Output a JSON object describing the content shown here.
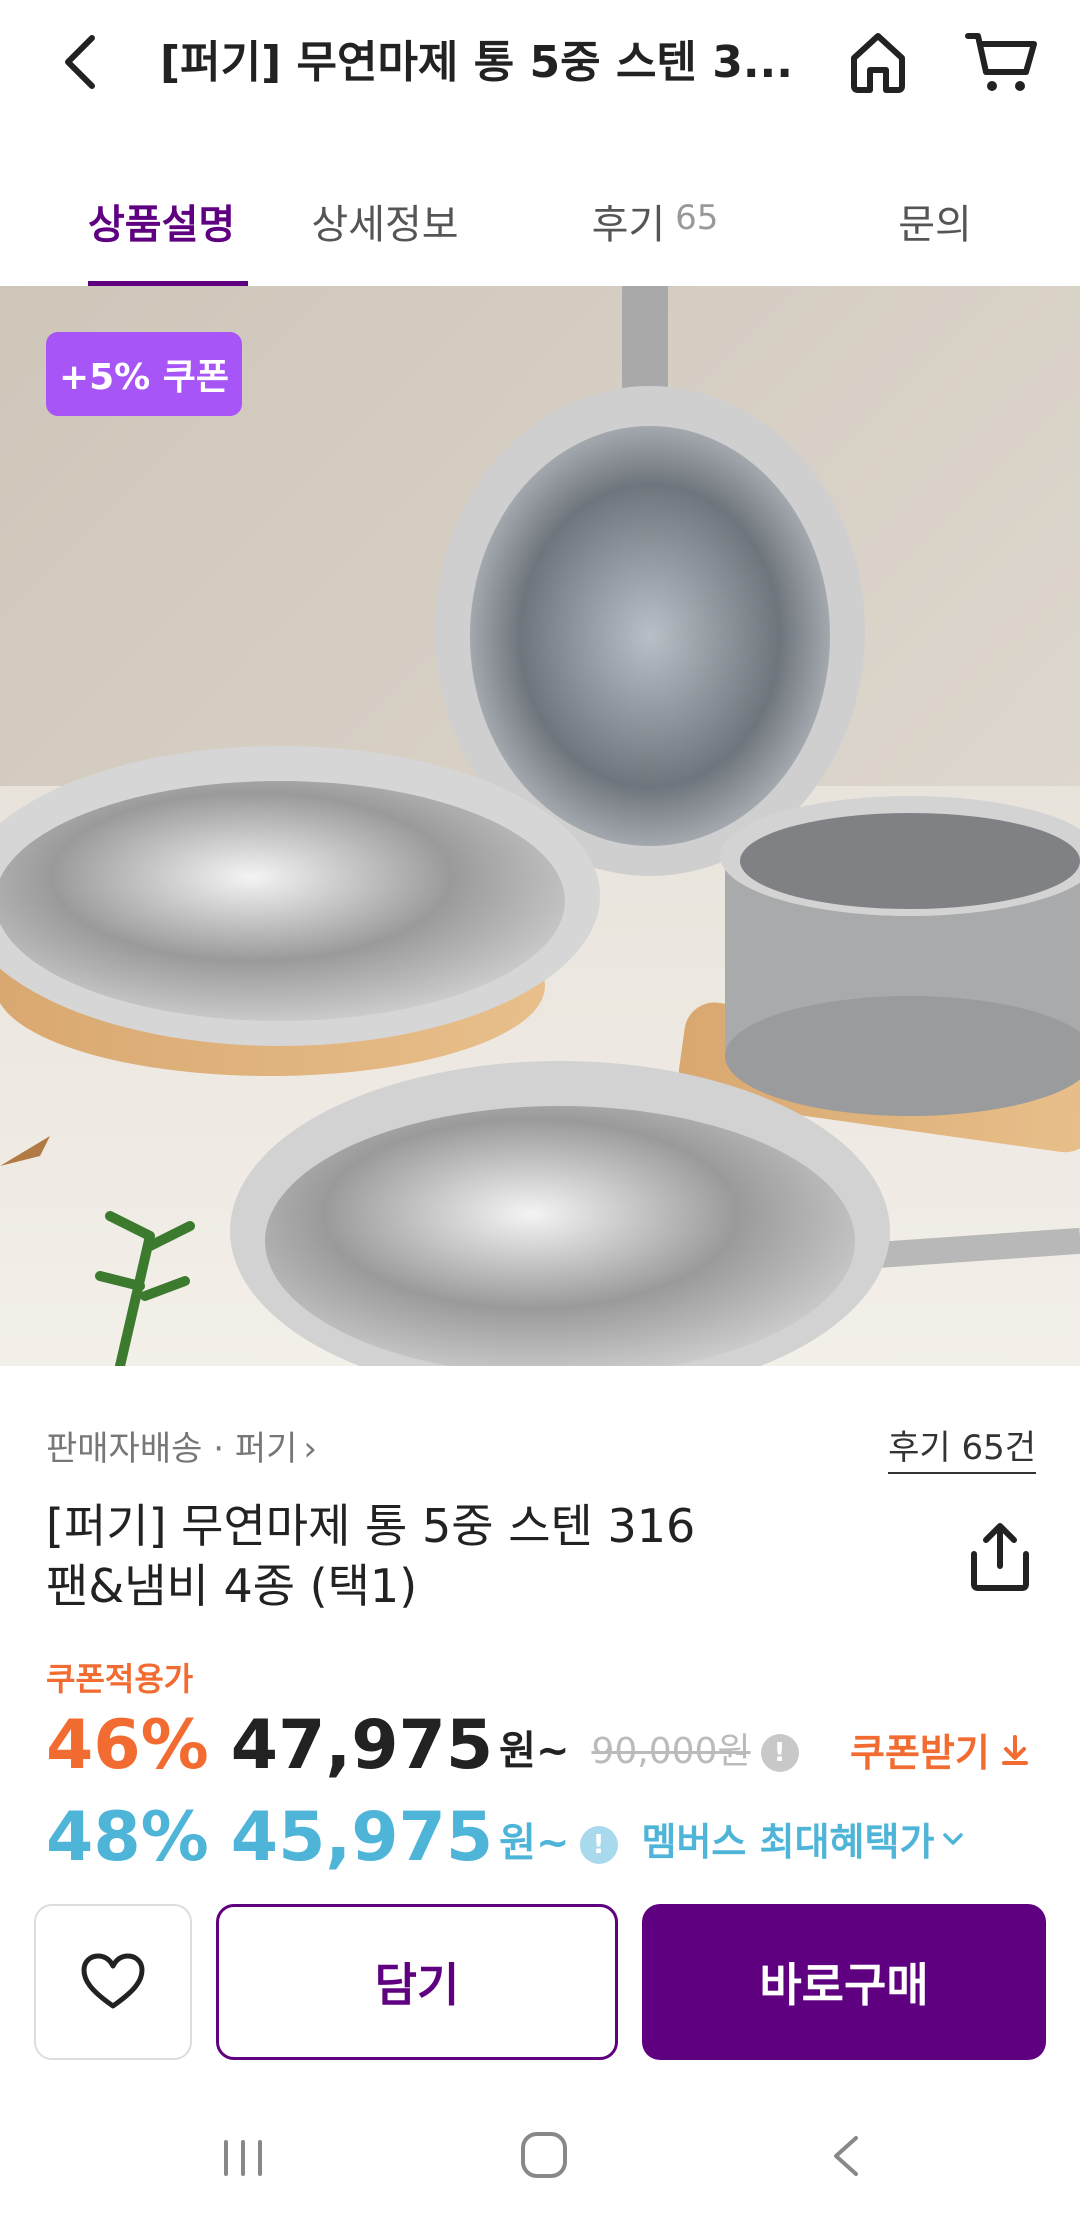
{
  "header": {
    "title": "[퍼기] 무연마제 통 5중 스텐 3...",
    "back_icon": "chevron-left-icon",
    "home_icon": "home-icon",
    "cart_icon": "cart-icon"
  },
  "tabs": [
    {
      "label": "상품설명",
      "active": true
    },
    {
      "label": "상세정보"
    },
    {
      "label": "후기",
      "count": "65"
    },
    {
      "label": "문의"
    }
  ],
  "hero": {
    "coupon_badge": "+5% 쿠폰"
  },
  "product": {
    "seller": "판매자배송 · 퍼기",
    "reviews_link": "후기 65건",
    "name_line1": "[퍼기] 무연마제 통 5중 스텐 316",
    "name_line2": "팬&냄비 4종 (택1)"
  },
  "price": {
    "coupon_label": "쿠폰적용가",
    "rate": "46%",
    "value": "47,975",
    "unit": "원~",
    "original": "90,000원",
    "info_glyph": "!",
    "coupon_get": "쿠폰받기"
  },
  "member": {
    "rate": "48%",
    "value": "45,975",
    "unit": "원~",
    "info_glyph": "!",
    "benefit_label": "멤버스 최대혜택가"
  },
  "actions": {
    "wish_icon": "heart-icon",
    "cart_label": "담기",
    "buy_label": "바로구매"
  },
  "colors": {
    "brand_purple": "#5f0080",
    "discount_orange": "#f26b30",
    "member_blue": "#4fb5d8",
    "badge_purple": "#a855f7"
  }
}
